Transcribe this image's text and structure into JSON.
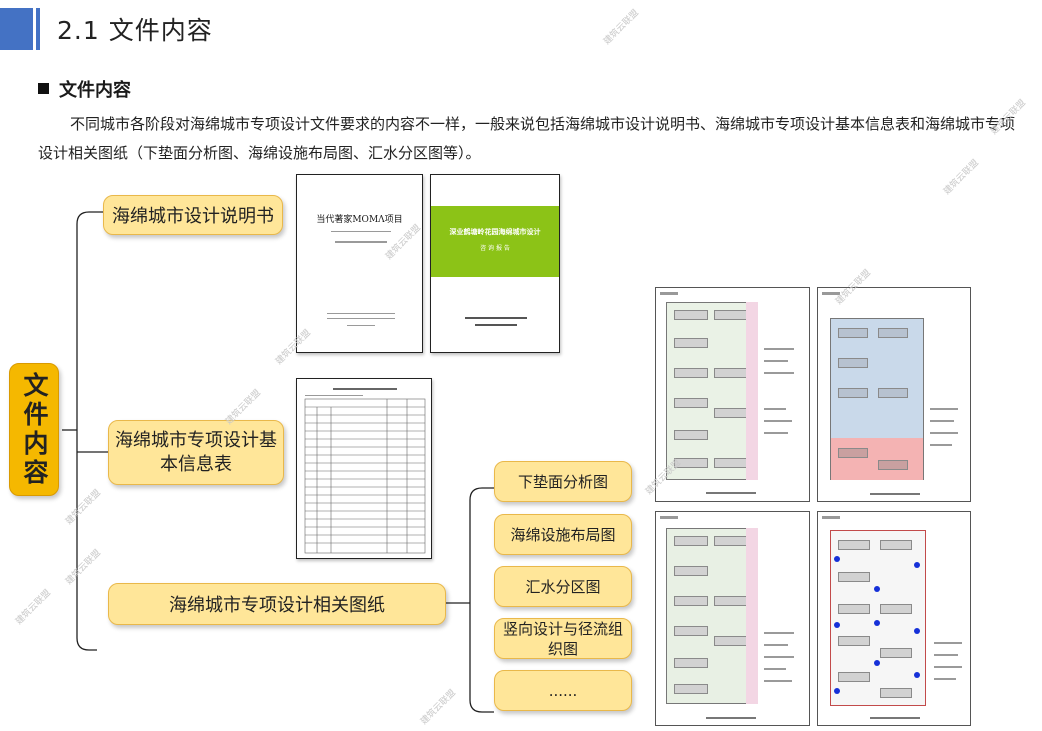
{
  "header": {
    "title": "2.1 文件内容"
  },
  "section": {
    "heading": "文件内容",
    "paragraph": "不同城市各阶段对海绵城市专项设计文件要求的内容不一样，一般来说包括海绵城市设计说明书、海绵城市专项设计基本信息表和海绵城市专项设计相关图纸（下垫面分析图、海绵设施布局图、汇水分区图等）。"
  },
  "diagram": {
    "root": "文件内容",
    "branches": [
      "海绵城市设计说明书",
      "海绵城市专项设计基本信息表",
      "海绵城市专项设计相关图纸"
    ],
    "drawings": [
      "下垫面分析图",
      "海绵设施布局图",
      "汇水分区图",
      "竖向设计与径流组织图",
      "......"
    ]
  },
  "docs": {
    "doc1_title": "当代著家MOMΛ项目",
    "doc2_title": "深业鹤塘岭花园海绵城市设计",
    "doc2_sub": "咨 询 报 告"
  },
  "watermark": "建筑云联盟",
  "colors": {
    "accent_blue": "#4472c4",
    "box_fill": "#ffe699",
    "box_border": "#e9b84a",
    "root_fill": "#f5b800",
    "report_green": "#8cc317",
    "layout_blue": "#1530d8"
  }
}
